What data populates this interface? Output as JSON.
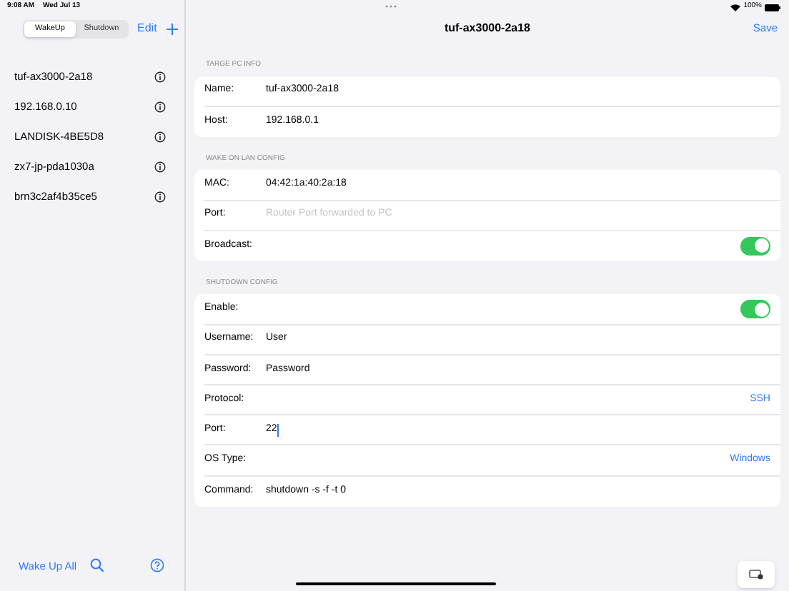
{
  "status_bar": {
    "time": "9:08 AM",
    "date": "Wed Jul 13",
    "battery": "100%"
  },
  "sidebar": {
    "segments": [
      {
        "label": "WakeUp",
        "selected": true
      },
      {
        "label": "Shutdown",
        "selected": false
      }
    ],
    "edit": "Edit",
    "items": [
      {
        "label": "tuf-ax3000-2a18"
      },
      {
        "label": "192.168.0.10"
      },
      {
        "label": "LANDISK-4BE5D8"
      },
      {
        "label": "zx7-jp-pda1030a"
      },
      {
        "label": "brn3c2af4b35ce5"
      }
    ],
    "wake_all": "Wake Up All"
  },
  "detail": {
    "title": "tuf-ax3000-2a18",
    "save": "Save",
    "sections": [
      {
        "header": "TARGE PC INFO",
        "rows": [
          {
            "kind": "text",
            "label": "Name:",
            "value": "tuf-ax3000-2a18"
          },
          {
            "kind": "text",
            "label": "Host:",
            "value": "192.168.0.1"
          }
        ]
      },
      {
        "header": "WAKE ON LAN CONFIG",
        "rows": [
          {
            "kind": "text",
            "label": "MAC:",
            "value": "04:42:1a:40:2a:18"
          },
          {
            "kind": "text",
            "label": "Port:",
            "placeholder": "Router Port forwarded to PC"
          },
          {
            "kind": "toggle",
            "label": "Broadcast:",
            "on": true
          }
        ]
      },
      {
        "header": "SHUTDOWN CONFIG",
        "rows": [
          {
            "kind": "toggle",
            "label": "Enable:",
            "on": true
          },
          {
            "kind": "text",
            "label": "Username:",
            "value": "User"
          },
          {
            "kind": "text",
            "label": "Password:",
            "value": "Password"
          },
          {
            "kind": "picker",
            "label": "Protocol:",
            "value": "SSH"
          },
          {
            "kind": "text",
            "label": "Port:",
            "value": "22",
            "focused": true
          },
          {
            "kind": "picker",
            "label": "OS Type:",
            "value": "Windows"
          },
          {
            "kind": "text",
            "label": "Command:",
            "value": "shutdown -s -f -t 0"
          }
        ]
      }
    ]
  }
}
